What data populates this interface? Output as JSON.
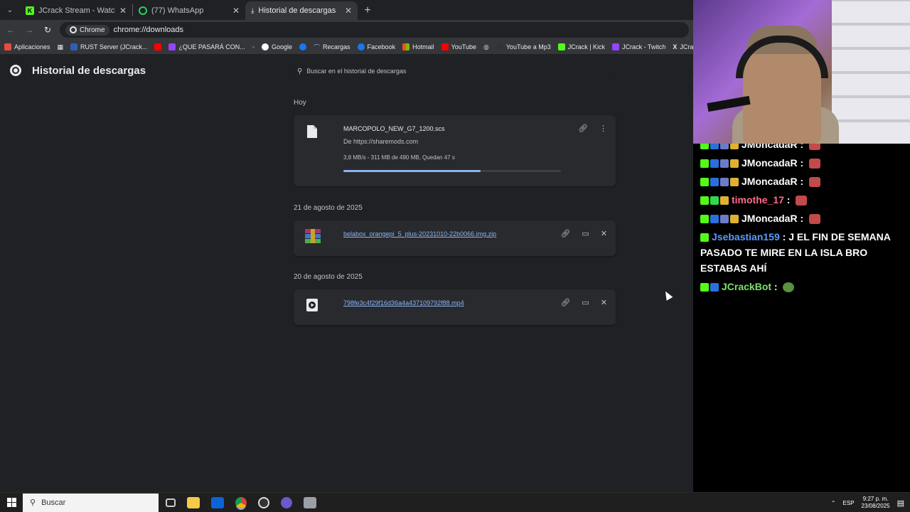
{
  "tabs": [
    {
      "title": "JCrack Stream - Watch Live on Kick",
      "favicon": "kick-icon"
    },
    {
      "title": "(77) WhatsApp",
      "favicon": "whatsapp-icon"
    },
    {
      "title": "Historial de descargas",
      "favicon": "download-icon"
    }
  ],
  "omnibox": {
    "chip": "Chrome",
    "url": "chrome://downloads"
  },
  "bookmarks": [
    "Aplicaciones",
    "RUST Server (JCrack...",
    "¿QUE PASARÁ CON...",
    "Google",
    "Recargas",
    "Facebook",
    "Hotmail",
    "YouTube",
    "YouTube a Mp3",
    "JCrack | Kick",
    "JCrack - Twitch",
    "JCrack (@JCrack"
  ],
  "page": {
    "title": "Historial de descargas",
    "search_placeholder": "Buscar en el historial de descargas"
  },
  "groups": [
    {
      "date": "Hoy",
      "item": {
        "filename": "MARCOPOLO_NEW_G7_1200.scs",
        "source": "De https://sharemods.com",
        "progress_text": "3,8 MB/s - 311 MB de 490 MB, Quedan 47 s",
        "progress_fraction": 0.63
      }
    },
    {
      "date": "21 de agosto de 2025",
      "item": {
        "filename": "belabox_orangepi_5_plus-20231010-22b0066.img.zip"
      }
    },
    {
      "date": "20 de agosto de 2025",
      "item": {
        "filename": "798fe3c4f29f16d36a4a437109792f88.mp4"
      }
    }
  ],
  "chat": [
    {
      "user": "JMoncadaR",
      "color": "#ffffff"
    },
    {
      "user": "JMoncadaR",
      "color": "#ffffff"
    },
    {
      "user": "JMoncadaR",
      "color": "#ffffff"
    },
    {
      "user": "timothe_17",
      "color": "#ff6b8a"
    },
    {
      "user": "JMoncadaR",
      "color": "#ffffff"
    },
    {
      "user": "Jsebastian159",
      "color": "#5b9cff",
      "text": "J EL FIN DE SEMANA PASADO TE MIRE EN LA ISLA BRO ESTABAS AHÍ"
    },
    {
      "user": "JCrackBot",
      "color": "#7be36a"
    }
  ],
  "taskbar": {
    "search_label": "Buscar",
    "lang": "ESP",
    "time": "9:27 p. m.",
    "date": "23/08/2025"
  },
  "colors": {
    "accent": "#8ab4f8",
    "kick_green": "#53fc18"
  }
}
